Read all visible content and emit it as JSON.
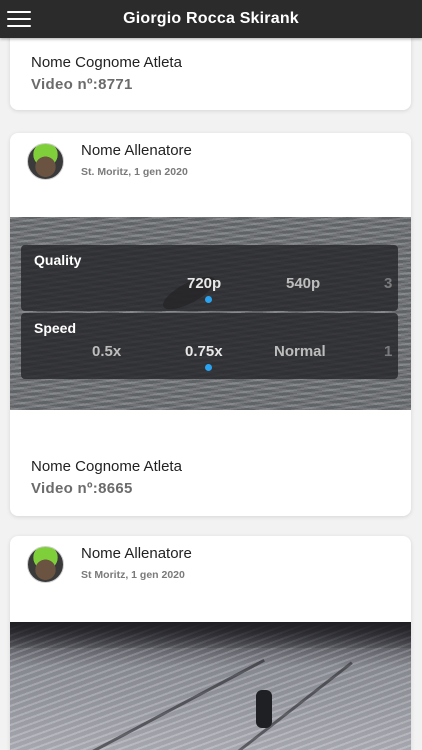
{
  "header": {
    "title": "Giorgio Rocca Skirank",
    "menu_icon": "hamburger-menu-icon"
  },
  "cards": [
    {
      "athlete": "Nome Cognome Atleta",
      "video_label": "Video nº:8771"
    },
    {
      "coach": "Nome Allenatore",
      "meta": "St. Moritz, 1 gen 2020",
      "player": {
        "quality_title": "Quality",
        "quality_options": [
          "720p",
          "540p",
          "3"
        ],
        "quality_selected": "720p",
        "speed_title": "Speed",
        "speed_options": [
          "0.5x",
          "0.75x",
          "Normal",
          "1"
        ],
        "speed_selected": "0.75x"
      },
      "athlete": "Nome Cognome Atleta",
      "video_label": "Video nº:8665"
    },
    {
      "coach": "Nome Allenatore",
      "meta": "St Moritz, 1 gen 2020"
    }
  ],
  "colors": {
    "topbar": "#2b2b2b",
    "selected_dot": "#2aa4f0"
  }
}
